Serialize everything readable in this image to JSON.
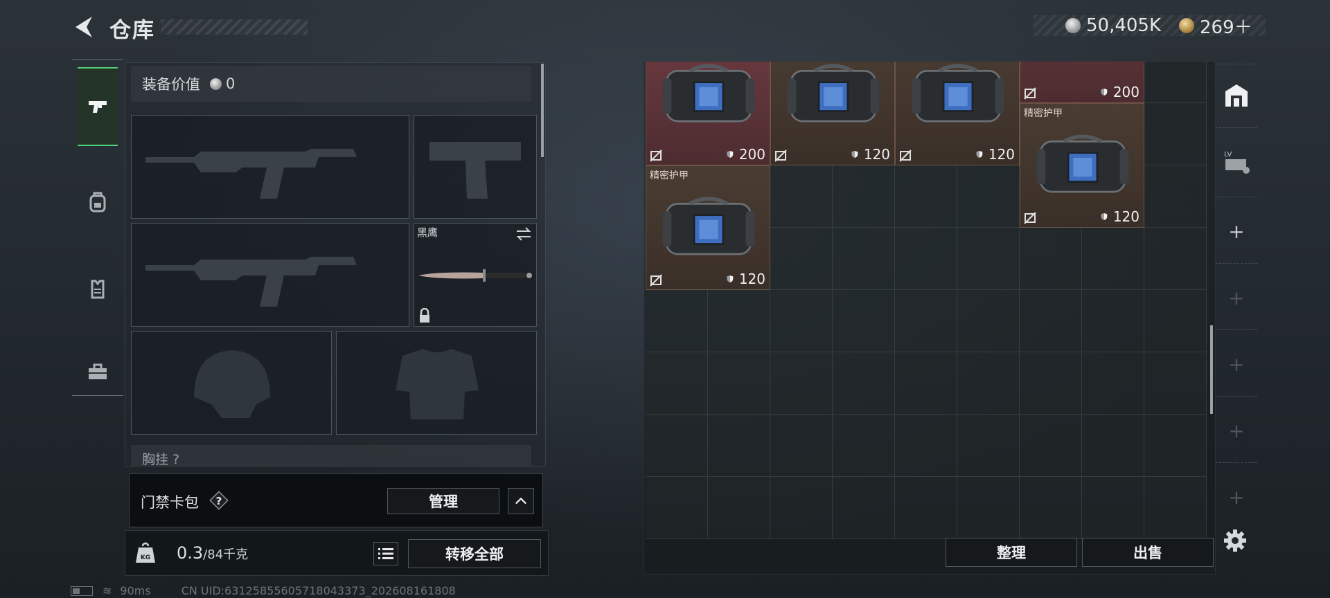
{
  "header": {
    "title": "仓库"
  },
  "currency": [
    {
      "icon": "silver-coin-icon",
      "value": "50,405K"
    },
    {
      "icon": "gold-coin-icon",
      "value": "269＋"
    }
  ],
  "tabs": [
    {
      "icon": "pistol-icon",
      "active": true
    },
    {
      "icon": "backpack-icon",
      "active": false
    },
    {
      "icon": "vest-icon",
      "active": false
    },
    {
      "icon": "toolbox-icon",
      "active": false
    }
  ],
  "loadout": {
    "equip_value_label": "装备价值",
    "equip_value": "0",
    "melee_name": "黑鹰",
    "chest_label": "胸挂 ?"
  },
  "keycard": {
    "label": "门禁卡包",
    "help": "?",
    "manage_label": "管理"
  },
  "bottom": {
    "weight_value": "0.3",
    "weight_max": "/84千克",
    "transfer_label": "转移全部"
  },
  "storage": {
    "items": [
      {
        "name": "",
        "durability": "200",
        "tint": "red"
      },
      {
        "name": "",
        "durability": "120",
        "tint": "brown"
      },
      {
        "name": "",
        "durability": "120",
        "tint": "brown"
      },
      {
        "name": "",
        "durability": "200",
        "tint": "red"
      },
      {
        "name": "精密护甲",
        "durability": "120",
        "tint": "brown"
      },
      {
        "name": "精密护甲",
        "durability": "120",
        "tint": "brown"
      }
    ],
    "sort_label": "整理",
    "sell_label": "出售"
  },
  "rail": {
    "level_label": "LV"
  },
  "status": {
    "ping": "90ms",
    "uid": "CN UID:63125855605718043373_202608161808"
  }
}
